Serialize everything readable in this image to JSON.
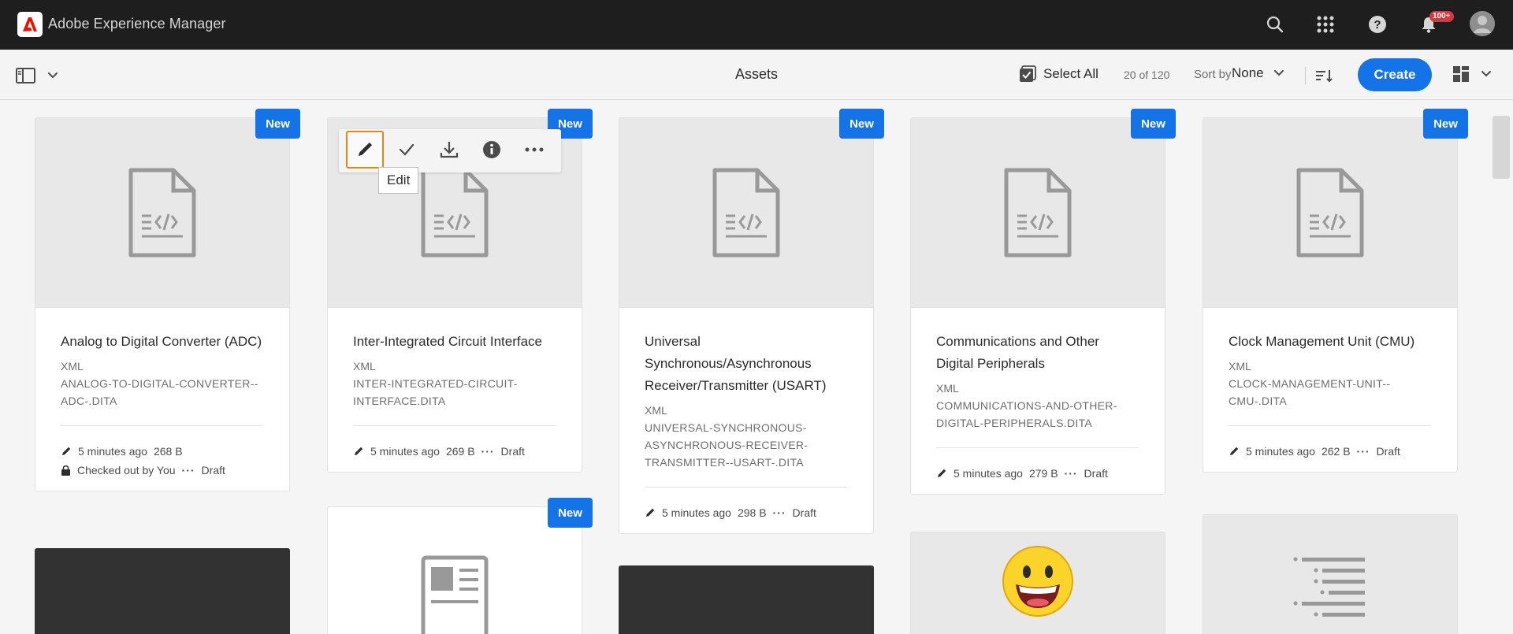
{
  "shell": {
    "app_title": "Adobe Experience Manager",
    "notification_count": "100+",
    "icons": [
      "adobe-logo",
      "search-icon",
      "apps-icon",
      "help-icon",
      "bell-icon",
      "user-avatar"
    ]
  },
  "actionbar": {
    "page_title": "Assets",
    "select_all_label": "Select All",
    "item_count": "20 of 120",
    "sort_label": "Sort by",
    "sort_value": "None",
    "create_label": "Create"
  },
  "colors": {
    "accent": "#1473e6",
    "focus": "#e68619",
    "shell": "#1e1e1e"
  },
  "badge_label": "New",
  "quick_actions": {
    "items": [
      "edit",
      "select",
      "download",
      "properties",
      "more"
    ],
    "tooltip": "Edit"
  },
  "cards": [
    {
      "title": "Analog to Digital Converter (ADC)",
      "type": "XML",
      "filename": "ANALOG-TO-DIGITAL-CONVERTER--ADC-.DITA",
      "modified": "5 minutes ago",
      "size": "268 B",
      "checked_out": "Checked out by You",
      "status": "Draft"
    },
    {
      "title": "Inter-Integrated Circuit Interface",
      "type": "XML",
      "filename": "INTER-INTEGRATED-CIRCUIT-INTERFACE.DITA",
      "modified": "5 minutes ago",
      "size": "269 B",
      "status": "Draft"
    },
    {
      "title": "Universal Synchronous/Asynchronous Receiver/Transmitter (USART)",
      "type": "XML",
      "filename": "UNIVERSAL-SYNCHRONOUS-ASYNCHRONOUS-RECEIVER-TRANSMITTER--USART-.DITA",
      "modified": "5 minutes ago",
      "size": "298 B",
      "status": "Draft"
    },
    {
      "title": "Communications and Other Digital Peripherals",
      "type": "XML",
      "filename": "COMMUNICATIONS-AND-OTHER-DIGITAL-PERIPHERALS.DITA",
      "modified": "5 minutes ago",
      "size": "279 B",
      "status": "Draft"
    },
    {
      "title": "Clock Management Unit (CMU)",
      "type": "XML",
      "filename": "CLOCK-MANAGEMENT-UNIT--CMU-.DITA",
      "modified": "5 minutes ago",
      "size": "262 B",
      "status": "Draft"
    }
  ]
}
